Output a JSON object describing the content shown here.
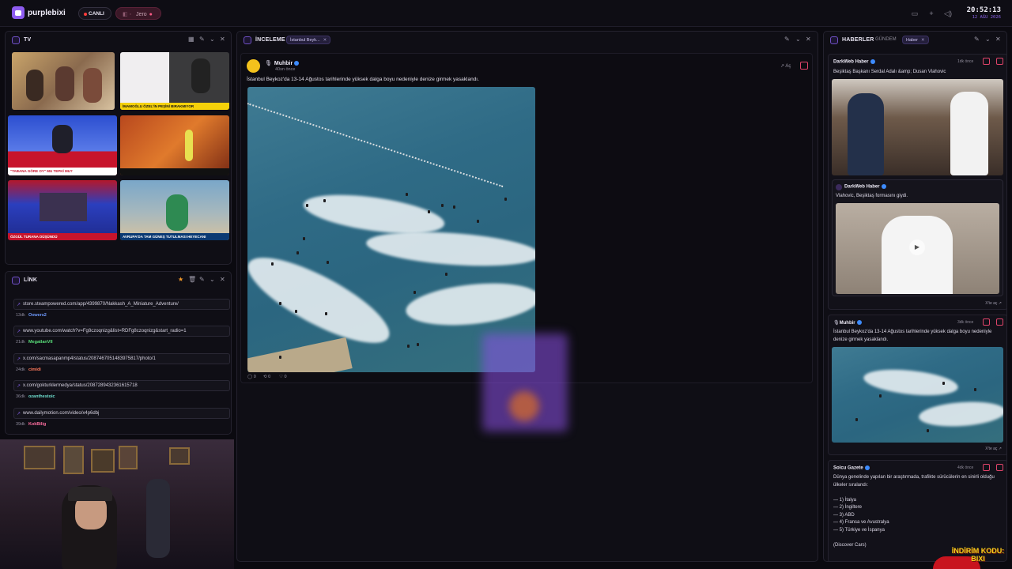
{
  "topbar": {
    "brand": "purplebixi",
    "live_label": "CANLI",
    "user_label": "Jero",
    "clock_time": "20:52:13",
    "clock_date": "12 AĞU 2026"
  },
  "tv": {
    "title": "TV",
    "thumbs": [
      {
        "banner": ""
      },
      {
        "banner": "İMAMOĞLU ÖZEL'İN PEŞİNİ BIRAKMIYOR"
      },
      {
        "banner": "\"TABANA GÖRE OY\" MU TEPKİ MU?"
      },
      {
        "banner": ""
      },
      {
        "banner": "ÖZGÜL TURANA DÜŞÜNDÜ"
      },
      {
        "banner": "AVRUPA'DA TAM GÜNEŞ TUTULMASI HEYECANI"
      }
    ]
  },
  "link": {
    "title": "LİNK",
    "items": [
      {
        "url": "store.steampowered.com/app/4399870/Nakkash_A_Miniature_Adventure/",
        "age": "13dk",
        "user": "Oxwers2",
        "color": "#6f9bff"
      },
      {
        "url": "www.youtube.com/watch?v=Fg8czoqnizg&list=RDFg8czoqnizg&start_radio=1",
        "age": "21dk",
        "user": "MegatlanVII",
        "color": "#59e07a"
      },
      {
        "url": "x.com/sacmasapanmp4/status/2087467051483975817/photo/1",
        "age": "24dk",
        "user": "cimidi",
        "color": "#ff7a5c"
      },
      {
        "url": "x.com/gokturklermedya/status/2087289432361615718",
        "age": "36dk",
        "user": "ozanthestoic",
        "color": "#6fe0d0"
      },
      {
        "url": "www.dailymotion.com/video/x4p6dbj",
        "age": "39dk",
        "user": "KokBilig",
        "color": "#ff6fa0"
      }
    ]
  },
  "inceleme": {
    "title": "İNCELEME",
    "chip": "İstanbul Beyk...",
    "post": {
      "author": "Muhbir",
      "time": "40sn önce",
      "open_label": "Aç",
      "text": "İstanbul Beykoz'da 13-14 Ağustos tarihlerinde yüksek dalga boyu nedeniyle denize girmek yasaklandı.",
      "replies": "0",
      "reposts": "0",
      "likes": "0"
    }
  },
  "haberler": {
    "title": "HABERLER",
    "tab_gundem": "GÜNDEM",
    "chip": "Haber",
    "cards": [
      {
        "author": "DarkWeb Haber",
        "time": "1dk önce",
        "text": "Beşiktaş Başkanı Serdal Adalı &amp; Dusan Vlahovic",
        "quote_author": "DarkWeb Haber",
        "quote_text": "Vlahovic, Beşiktaş formasını giydi.",
        "open_label": "X'te aç"
      },
      {
        "author": "Muhbir",
        "time": "3dk önce",
        "text": "İstanbul Beykoz'da 13-14 Ağustos tarihlerinde yüksek dalga boyu nedeniyle denize girmek yasaklandı.",
        "open_label": "X'te aç"
      },
      {
        "author": "Solcu Gazete",
        "time": "4dk önce",
        "lines": [
          "Dünya genelinde yapılan bir araştırmada, trafikte sürücülerin en sinirli olduğu ülkeler sıralandı:",
          "",
          "— 1) İtalya",
          "— 2) İngiltere",
          "— 3) ABD",
          "— 4) Fransa ve Avustralya",
          "— 5) Türkiye ve İspanya",
          "",
          "(Discover Cars)"
        ]
      }
    ]
  },
  "overlay": {
    "promo": "İNDİRİM KODU: BIXI"
  },
  "colors": {
    "accent": "#8e5cf0",
    "live": "#ff3b3b",
    "verified": "#3d8bfd"
  }
}
